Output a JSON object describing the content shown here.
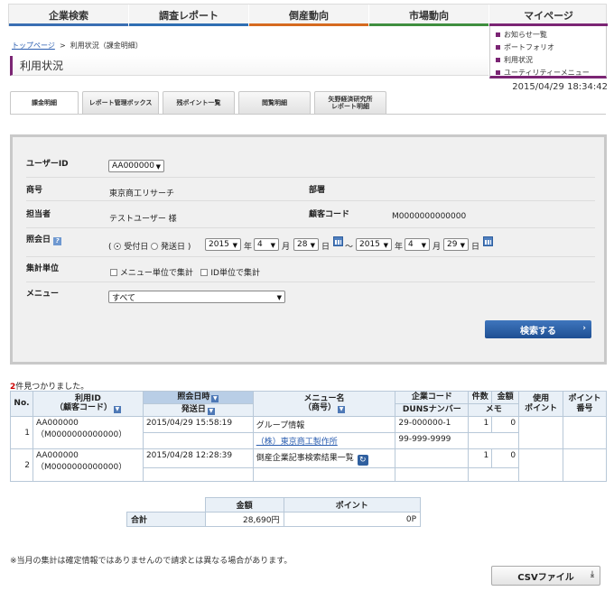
{
  "nav": {
    "items": [
      {
        "label": "企業検索",
        "color": "#3a6fb3"
      },
      {
        "label": "調査レポート",
        "color": "#2f6fb3"
      },
      {
        "label": "倒産動向",
        "color": "#d66a1f"
      },
      {
        "label": "市場動向",
        "color": "#3f8f3f"
      },
      {
        "label": "マイページ",
        "color": "#7b2574"
      }
    ]
  },
  "mypage_menu": [
    "お知らせ一覧",
    "ポートフォリオ",
    "利用状況",
    "ユーティリティーメニュー"
  ],
  "breadcrumb": {
    "home": "トップページ",
    "sep": ">",
    "current": "利用状況（課金明細）"
  },
  "page_title": "利用状況",
  "timestamp": "2015/04/29 18:34:42",
  "tabs": [
    {
      "label": "課金明細"
    },
    {
      "label": "レポート管理ボックス"
    },
    {
      "label": "残ポイント一覧"
    },
    {
      "label": "閲覧明細"
    },
    {
      "label": "矢野経済研究所\nレポート明細"
    }
  ],
  "form": {
    "user_id_label": "ユーザーID",
    "user_id_value": "AA000000",
    "company_label": "商号",
    "company_value": "東京商工リサーチ",
    "dept_label": "部署",
    "person_label": "担当者",
    "person_value": "テストユーザー 様",
    "customer_code_label": "顧客コード",
    "customer_code_value": "M0000000000000",
    "date_label": "照会日",
    "date_help": "?",
    "paren_open": "(",
    "radio_received": "受付日",
    "radio_sent": "発送日",
    "paren_close": ")",
    "from_year": "2015",
    "from_month": "4",
    "from_day": "28",
    "to_year": "2015",
    "to_month": "4",
    "to_day": "29",
    "year_unit": "年",
    "month_unit": "月",
    "day_unit": "日",
    "range_sep": "～",
    "agg_label": "集計単位",
    "agg_menu": "メニュー単位で集計",
    "agg_id": "ID単位で集計",
    "menu_label": "メニュー",
    "menu_value": "すべて",
    "search_button": "検索する",
    "chev": "›"
  },
  "result_count": {
    "count": "2",
    "suffix": "件見つかりました。"
  },
  "table": {
    "headers": {
      "no": "No.",
      "user_id": "利用ID",
      "user_sub": "（顧客コード）",
      "query_dt": "照会日時",
      "sent_date": "発送日",
      "menu": "メニュー名",
      "menu_sub": "（商号）",
      "corp_code": "企業コード",
      "duns": "DUNSナンバー",
      "count": "件数",
      "amount": "金額",
      "memo": "メモ",
      "used_points": "使用\nポイント",
      "point_no": "ポイント\n番号"
    },
    "rows": [
      {
        "no": "1",
        "user_id": "AA000000",
        "cust_code": "（M0000000000000）",
        "query_dt": "2015/04/29 15:58:19",
        "sent": "",
        "menu": "グループ情報",
        "company": "（株）東京商工製作所",
        "corp_code": "29-000000-1",
        "duns": "99-999-9999",
        "count": "1",
        "amount": "0"
      },
      {
        "no": "2",
        "user_id": "AA000000",
        "cust_code": "（M0000000000000）",
        "query_dt": "2015/04/28 12:28:39",
        "sent": "",
        "menu": "倒産企業記事検索結果一覧",
        "company": "",
        "corp_code": "",
        "duns": "",
        "count": "1",
        "amount": "0"
      }
    ]
  },
  "totals": {
    "amount_header": "金額",
    "points_header": "ポイント",
    "row_label": "合計",
    "amount": "28,690円",
    "points": "0P"
  },
  "note": "※当月の集計は確定情報ではありませんので請求とは異なる場合があります。",
  "csv_button": "CSVファイル",
  "icons": {
    "sort": "▼",
    "reload": "↻",
    "download": "⤓",
    "dropdown": "▼",
    "help": "?"
  }
}
